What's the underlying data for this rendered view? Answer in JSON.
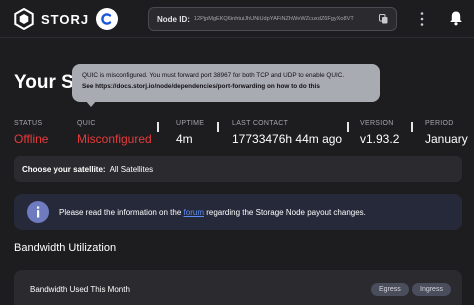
{
  "brand": {
    "name": "STORJ"
  },
  "header": {
    "node_id_label": "Node ID:",
    "node_id_value": "12PjpMgEKQ6inhtuiJhUNiUdpYAFiNZhWeWZcuxdZ6FgyXo8VT",
    "icons": [
      "storj-logo-icon",
      "theme-toggle-icon",
      "copy-icon",
      "more-vertical-icon",
      "bell-icon"
    ]
  },
  "page": {
    "title": "Your St"
  },
  "tooltip": {
    "text": "QUIC is misconfigured. You must forward port 38967 for both TCP and UDP to enable QUIC.",
    "link": "See https://docs.storj.io/node/dependencies/port-forwarding on how to do this"
  },
  "stats": [
    {
      "label": "STATUS",
      "value": "Offline",
      "status": "bad"
    },
    {
      "label": "QUIC",
      "value": "Misconfigured",
      "status": "bad"
    },
    {
      "label": "UPTIME",
      "value": "4m",
      "status": "normal"
    },
    {
      "label": "LAST CONTACT",
      "value": "17733476h 44m ago",
      "status": "normal"
    },
    {
      "label": "VERSION",
      "value": "v1.93.2",
      "status": "normal"
    },
    {
      "label": "PERIOD",
      "value": "January",
      "status": "normal"
    }
  ],
  "satellite": {
    "label": "Choose your satellite:",
    "value": "All Satellites"
  },
  "notice": {
    "prefix": "Please read the information on the",
    "link": "forum",
    "suffix": "regarding the Storage Node payout changes."
  },
  "bandwidth": {
    "section_title": "Bandwidth Utilization",
    "card_title": "Bandwidth Used This Month",
    "egress_label": "Egress",
    "ingress_label": "Ingress"
  },
  "colors": {
    "background": "#1d1d20",
    "error": "#e63b3b",
    "link": "#5c8df7",
    "card": "#2a2a2f",
    "notice": "#26293a"
  }
}
